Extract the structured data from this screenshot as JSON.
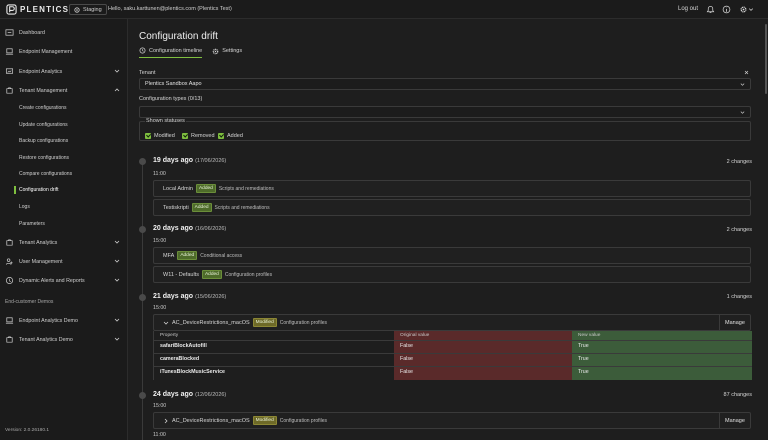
{
  "app": {
    "brand": "PLENTICS",
    "environment": "Staging",
    "greeting": "Hello, saku.karttunen@plentics.com (Plentics Test)",
    "logout": "Log out"
  },
  "sidebar": {
    "items": [
      {
        "label": "Dashboard",
        "icon": "dashboard-icon"
      },
      {
        "label": "Endpoint Management",
        "icon": "laptop-icon"
      },
      {
        "label": "Endpoint Analytics",
        "icon": "analytics-icon"
      },
      {
        "label": "Tenant Management",
        "icon": "tenant-icon"
      }
    ],
    "sub_items": [
      "Create configurations",
      "Update configurations",
      "Backup configurations",
      "Restore configurations",
      "Compare configurations",
      "Configuration drift",
      "Logs",
      "Parameters"
    ],
    "items2": [
      {
        "label": "Tenant Analytics",
        "icon": "tenant-analytics-icon"
      },
      {
        "label": "User Management",
        "icon": "user-icon"
      },
      {
        "label": "Dynamic Alerts and Reports",
        "icon": "alert-icon"
      }
    ],
    "section": "End-customer Demos",
    "demos": [
      {
        "label": "Endpoint Analytics Demo",
        "icon": "laptop-icon"
      },
      {
        "label": "Tenant Analytics Demo",
        "icon": "tenant-icon"
      }
    ],
    "version": "Version: 2.0.26180.1"
  },
  "page": {
    "title": "Configuration drift",
    "tabs": [
      "Configuration timeline",
      "Settings"
    ],
    "tenant_label": "Tenant",
    "tenant_value": "Plentics Sandbox Aapo",
    "types_label": "Configuration types (0/13)",
    "statuses_label": "Shown statuses",
    "statuses": [
      "Modified",
      "Removed",
      "Added"
    ]
  },
  "groups": [
    {
      "ago": "19 days ago",
      "date": "(17/06/2026)",
      "count": "2 changes",
      "time": "11:00",
      "items": [
        {
          "name": "Local Admin",
          "badge": "Added",
          "cat": "Scripts and remediations"
        },
        {
          "name": "Testiskripti",
          "badge": "Added",
          "cat": "Scripts and remediations"
        }
      ]
    },
    {
      "ago": "20 days ago",
      "date": "(16/06/2026)",
      "count": "2 changes",
      "time": "15:00",
      "items": [
        {
          "name": "MFA",
          "badge": "Added",
          "cat": "Conditional access"
        },
        {
          "name": "W11 - Defaults",
          "badge": "Added",
          "cat": "Configuration profiles"
        }
      ]
    },
    {
      "ago": "21 days ago",
      "date": "(15/06/2026)",
      "count": "1 changes",
      "time": "15:00",
      "items": [
        {
          "name": "AC_DeviceRestrictions_macOS",
          "badge": "Modified",
          "cat": "Configuration profiles",
          "manage": "Manage"
        }
      ],
      "table": {
        "headers": [
          "Property",
          "Original value",
          "New value"
        ],
        "rows": [
          [
            "safariBlockAutofill",
            "False",
            "True"
          ],
          [
            "cameraBlocked",
            "False",
            "True"
          ],
          [
            "iTunesBlockMusicService",
            "False",
            "True"
          ]
        ]
      }
    },
    {
      "ago": "24 days ago",
      "date": "(12/06/2026)",
      "count": "87 changes",
      "time": "15:00",
      "items": [
        {
          "name": "AC_DeviceRestrictions_macOS",
          "badge": "Modified",
          "cat": "Configuration profiles",
          "manage": "Manage"
        }
      ],
      "time2": "11:00"
    }
  ]
}
